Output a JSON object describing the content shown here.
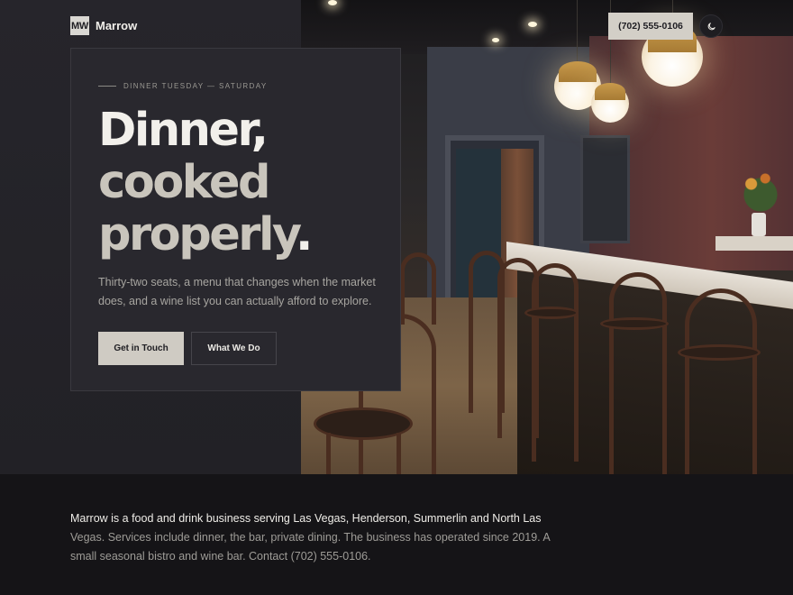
{
  "header": {
    "logo_mark": "MW",
    "brand_name": "Marrow",
    "phone": "(702) 555-0106"
  },
  "hero": {
    "eyebrow": "DINNER TUESDAY — SATURDAY",
    "headline_line1": "Dinner,",
    "headline_line2": "cooked",
    "headline_line3": "properly",
    "headline_dot": ".",
    "body": "Thirty-two seats, a menu that changes when the market does, and a wine list you can actually afford to explore.",
    "primary_cta": "Get in Touch",
    "secondary_cta": "What We Do"
  },
  "footer": {
    "lead": "Marrow is a food and drink business serving Las Vegas, Henderson, Summerlin and North Las",
    "rest": " Vegas. Services include dinner, the bar, private dining. The business has operated since 2019. A small seasonal bistro and wine bar. Contact (702) 555-0106."
  },
  "icons": {
    "theme_toggle": "moon-icon"
  },
  "colors": {
    "background": "#25242a",
    "card": "#29282e",
    "accent": "#cfcbc3",
    "footer": "#151417"
  }
}
